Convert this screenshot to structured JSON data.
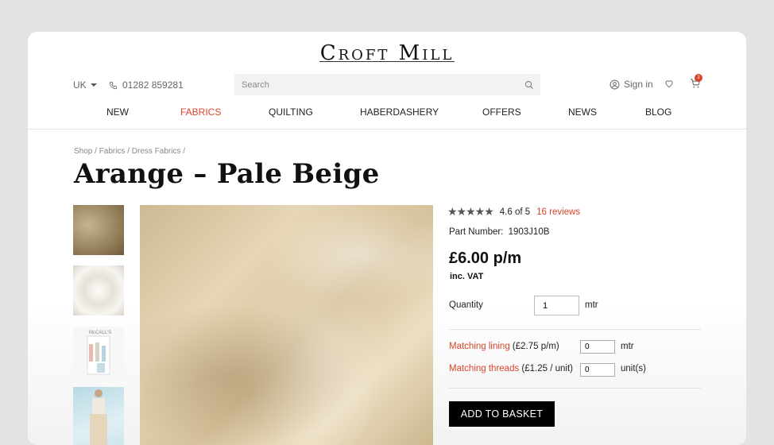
{
  "header": {
    "logo": "Croft Mill",
    "locale": "UK",
    "phone": "01282 859281",
    "search_placeholder": "Search",
    "signin": "Sign in",
    "cart_count": "2",
    "icons": [
      "phone-icon",
      "search-icon",
      "user-icon",
      "heart-icon",
      "cart-icon"
    ]
  },
  "nav": [
    "NEW",
    "FABRICS",
    "QUILTING",
    "HABERDASHERY",
    "OFFERS",
    "NEWS",
    "BLOG"
  ],
  "breadcrumb": "Shop / Fabrics / Dress Fabrics /",
  "product": {
    "title": "Arange – Pale Beige",
    "rating_text": "4.6 of 5",
    "rating_value": 4.6,
    "reviews": "16 reviews",
    "part_label": "Part Number:",
    "part_number": "1903J10B",
    "price": "£6.00 p/m",
    "vat": "inc. VAT",
    "quantity_label": "Quantity",
    "quantity_value": "1",
    "quantity_unit": "mtr",
    "lining_link": "Matching lining",
    "lining_price": "(£2.75 p/m)",
    "lining_value": "0",
    "lining_unit": "mtr",
    "threads_link": "Matching threads",
    "threads_price": "(£1.25 / unit)",
    "threads_value": "0",
    "threads_unit": "unit(s)",
    "add_button": "ADD TO BASKET",
    "thumb3_text": "McCALL'S"
  },
  "colors": {
    "accent": "#d9452b",
    "button": "#000000",
    "fabric": "#dccaa5"
  }
}
